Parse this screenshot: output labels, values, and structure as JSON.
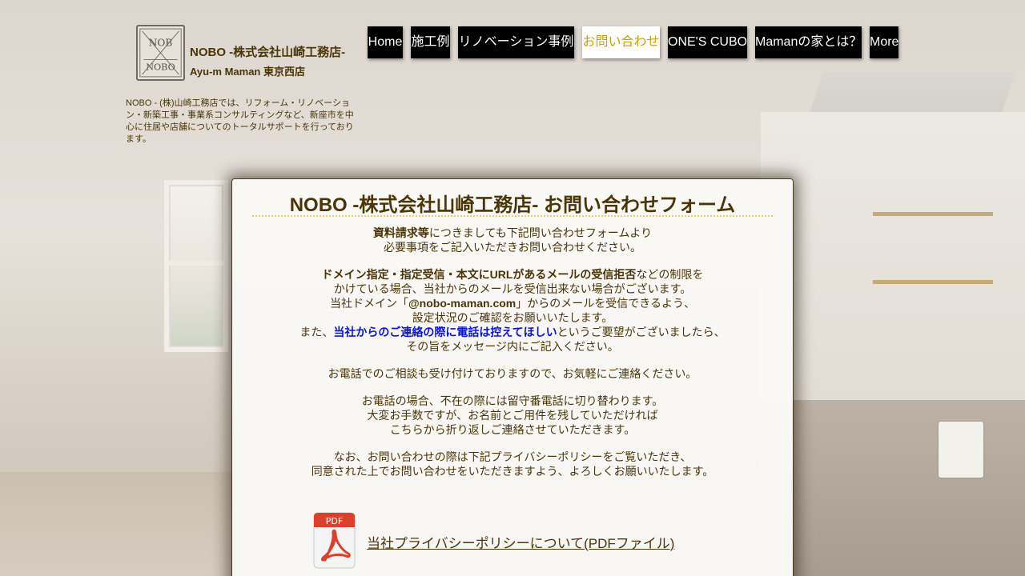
{
  "site": {
    "title": "NOBO -株式会社山崎工務店-",
    "subtitle": "Ayu-m Maman 東京西店",
    "description": "NOBO - (株)山崎工務店では、リフォーム・リノベーション・新築工事・事業系コンサルティングなど、新座市を中心に住居や店舗についてのトータルサポートを行っております。",
    "logo_text_top": "NOB",
    "logo_text_bottom": "NOBO"
  },
  "nav": {
    "items": [
      {
        "label": "Home",
        "active": false
      },
      {
        "label": "施工例",
        "active": false
      },
      {
        "label": "リノベーション事例",
        "active": false
      },
      {
        "label": "お問い合わせ",
        "active": true
      },
      {
        "label": "ONE'S CUBO",
        "active": false
      },
      {
        "label": "Mamanの家とは？",
        "active": false
      },
      {
        "label": "More",
        "active": false
      }
    ]
  },
  "content": {
    "heading": "NOBO -株式会社山崎工務店- お問い合わせフォーム",
    "p1_bold": "資料請求等",
    "p1_rest": "につきましても下記問い合わせフォームより",
    "p1_line2": "必要事項をご記入いただきお問い合わせください。",
    "p2_bold": "ドメイン指定・指定受信・本文にURLがあるメールの受信拒否",
    "p2_rest": "などの制限を",
    "p2_line2": "かけている場合、当社からのメールを受信出来ない場合がございます。",
    "p2_line3_pre": "当社ドメイン「",
    "p2_domain": "@nobo-maman.com",
    "p2_line3_post": "」からのメールを受信できるよう、",
    "p2_line4": "設定状況のご確認をお願いいたします。",
    "p2_line5_pre": "また、",
    "p2_line5_blue": "当社からのご連絡の際に電話は控えてほしい",
    "p2_line5_post": "というご要望がございましたら、",
    "p2_line6": "その旨をメッセージ内にご記入ください。",
    "p3": "お電話でのご相談も受け付けておりますので、お気軽にご連絡ください。",
    "p4_line1": "お電話の場合、不在の際には留守番電話に切り替わります。",
    "p4_line2": "大変お手数ですが、お名前とご用件を残していただければ",
    "p4_line3": "こちらから折り返しご連絡させていただきます。",
    "p5_line1": "なお、お問い合わせの際は下記プライバシーポリシーをご覧いただき、",
    "p5_line2": "同意された上でお問い合わせをいただきますよう、よろしくお願いいたします。",
    "pdf_badge": "PDF",
    "pdf_link": "当社プライバシーポリシーについて(PDFファイル)"
  },
  "colors": {
    "brand_text": "#4a3508",
    "nav_bg": "#000000",
    "nav_active_text": "#c9a106",
    "highlight_blue": "#0a14d6",
    "pdf_red": "#d9412c"
  }
}
